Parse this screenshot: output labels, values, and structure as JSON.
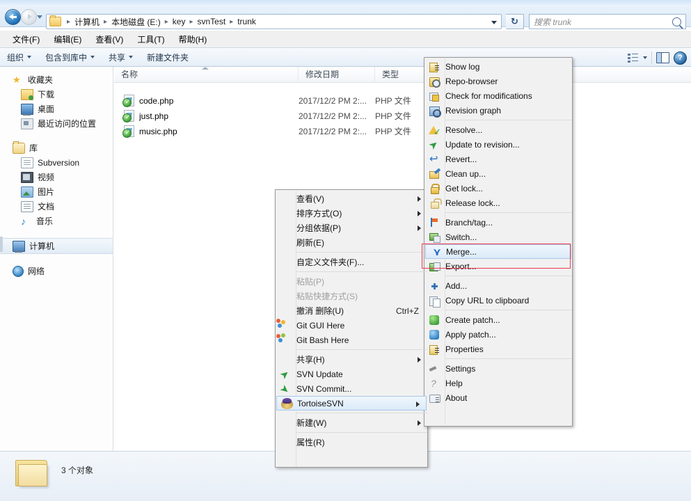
{
  "window": {
    "search_placeholder": "搜索 trunk",
    "refresh_icon": "refresh-icon",
    "search_icon": "search-icon"
  },
  "breadcrumb": {
    "folder_icon": "folder-icon",
    "items": [
      "计算机",
      "本地磁盘 (E:)",
      "key",
      "svnTest",
      "trunk"
    ],
    "separator": "▸"
  },
  "menubar": {
    "items": [
      "文件(F)",
      "编辑(E)",
      "查看(V)",
      "工具(T)",
      "帮助(H)"
    ]
  },
  "commandbar": {
    "items": [
      {
        "label": "组织",
        "has_caret": true
      },
      {
        "label": "包含到库中",
        "has_caret": true
      },
      {
        "label": "共享",
        "has_caret": true
      },
      {
        "label": "新建文件夹",
        "has_caret": false
      }
    ],
    "view_icon": "view-options-icon",
    "pane_icon": "preview-pane-icon",
    "help_icon": "help-icon",
    "help_glyph": "?"
  },
  "navpane": {
    "groups": [
      {
        "header": {
          "label": "收藏夹",
          "icon": "star-icon",
          "glyph": "★"
        },
        "items": [
          {
            "label": "下载",
            "icon": "downloads-icon"
          },
          {
            "label": "桌面",
            "icon": "desktop-icon"
          },
          {
            "label": "最近访问的位置",
            "icon": "recent-places-icon"
          }
        ]
      },
      {
        "header": {
          "label": "库",
          "icon": "library-icon"
        },
        "items": [
          {
            "label": "Subversion",
            "icon": "subversion-library-icon"
          },
          {
            "label": "视频",
            "icon": "videos-icon"
          },
          {
            "label": "图片",
            "icon": "pictures-icon"
          },
          {
            "label": "文档",
            "icon": "documents-icon"
          },
          {
            "label": "音乐",
            "icon": "music-icon",
            "glyph": "♪"
          }
        ]
      },
      {
        "header": {
          "label": "计算机",
          "icon": "computer-icon",
          "selected": true
        },
        "items": []
      },
      {
        "header": {
          "label": "网络",
          "icon": "network-icon"
        },
        "items": []
      }
    ]
  },
  "filelist": {
    "columns": [
      {
        "key": "name",
        "label": "名称",
        "sorted": true
      },
      {
        "key": "date",
        "label": "修改日期"
      },
      {
        "key": "type",
        "label": "类型"
      }
    ],
    "rows": [
      {
        "name": "code.php",
        "date": "2017/12/2 PM 2:...",
        "type": "PHP 文件",
        "icon": "php-file-icon",
        "overlay": "svn-normal-overlay"
      },
      {
        "name": "just.php",
        "date": "2017/12/2 PM 2:...",
        "type": "PHP 文件",
        "icon": "php-file-icon",
        "overlay": "svn-normal-overlay"
      },
      {
        "name": "music.php",
        "date": "2017/12/2 PM 2:...",
        "type": "PHP 文件",
        "icon": "php-file-icon",
        "overlay": "svn-normal-overlay"
      }
    ]
  },
  "statusbar": {
    "folder_icon": "folder-large-icon",
    "text": "3 个对象"
  },
  "context_menu": {
    "items": [
      {
        "label": "查看(V)",
        "submenu": true,
        "type": "item"
      },
      {
        "label": "排序方式(O)",
        "submenu": true,
        "type": "item"
      },
      {
        "label": "分组依据(P)",
        "submenu": true,
        "type": "item"
      },
      {
        "label": "刷新(E)",
        "type": "item"
      },
      {
        "type": "separator"
      },
      {
        "label": "自定义文件夹(F)...",
        "type": "item"
      },
      {
        "type": "separator"
      },
      {
        "label": "粘贴(P)",
        "type": "item",
        "disabled": true
      },
      {
        "label": "粘贴快捷方式(S)",
        "type": "item",
        "disabled": true
      },
      {
        "label": "撤消 删除(U)",
        "type": "item",
        "accel": "Ctrl+Z"
      },
      {
        "label": "Git GUI Here",
        "type": "item",
        "icon": "git-gui-icon"
      },
      {
        "label": "Git Bash Here",
        "type": "item",
        "icon": "git-bash-icon"
      },
      {
        "type": "separator"
      },
      {
        "label": "共享(H)",
        "type": "item",
        "submenu": true
      },
      {
        "label": "SVN Update",
        "type": "item",
        "icon": "svn-update-icon"
      },
      {
        "label": "SVN Commit...",
        "type": "item",
        "icon": "svn-commit-icon"
      },
      {
        "label": "TortoiseSVN",
        "type": "item",
        "submenu": true,
        "icon": "tortoisesvn-icon",
        "highlighted": true
      },
      {
        "type": "separator"
      },
      {
        "label": "新建(W)",
        "type": "item",
        "submenu": true
      },
      {
        "type": "separator"
      },
      {
        "label": "属性(R)",
        "type": "item"
      }
    ]
  },
  "submenu": {
    "items": [
      {
        "label": "Show log",
        "icon": "show-log-icon"
      },
      {
        "label": "Repo-browser",
        "icon": "repo-browser-icon"
      },
      {
        "label": "Check for modifications",
        "icon": "check-modifications-icon"
      },
      {
        "label": "Revision graph",
        "icon": "revision-graph-icon"
      },
      {
        "type": "separator"
      },
      {
        "label": "Resolve...",
        "icon": "resolve-icon"
      },
      {
        "label": "Update to revision...",
        "icon": "update-to-revision-icon"
      },
      {
        "label": "Revert...",
        "icon": "revert-icon"
      },
      {
        "label": "Clean up...",
        "icon": "clean-up-icon"
      },
      {
        "label": "Get lock...",
        "icon": "get-lock-icon"
      },
      {
        "label": "Release lock...",
        "icon": "release-lock-icon"
      },
      {
        "type": "separator"
      },
      {
        "label": "Branch/tag...",
        "icon": "branch-tag-icon"
      },
      {
        "label": "Switch...",
        "icon": "switch-icon"
      },
      {
        "label": "Merge...",
        "icon": "merge-icon",
        "highlighted": true
      },
      {
        "label": "Export...",
        "icon": "export-icon"
      },
      {
        "type": "separator"
      },
      {
        "label": "Add...",
        "icon": "add-icon"
      },
      {
        "label": "Copy URL to clipboard",
        "icon": "copy-url-icon"
      },
      {
        "type": "separator"
      },
      {
        "label": "Create patch...",
        "icon": "create-patch-icon"
      },
      {
        "label": "Apply patch...",
        "icon": "apply-patch-icon"
      },
      {
        "label": "Properties",
        "icon": "properties-icon"
      },
      {
        "type": "separator"
      },
      {
        "label": "Settings",
        "icon": "settings-icon"
      },
      {
        "label": "Help",
        "icon": "help-icon"
      },
      {
        "label": "About",
        "icon": "about-icon"
      }
    ]
  },
  "annotation": {
    "highlight_color": "#ef3b4e",
    "covers": [
      "Switch...",
      "Merge..."
    ]
  }
}
